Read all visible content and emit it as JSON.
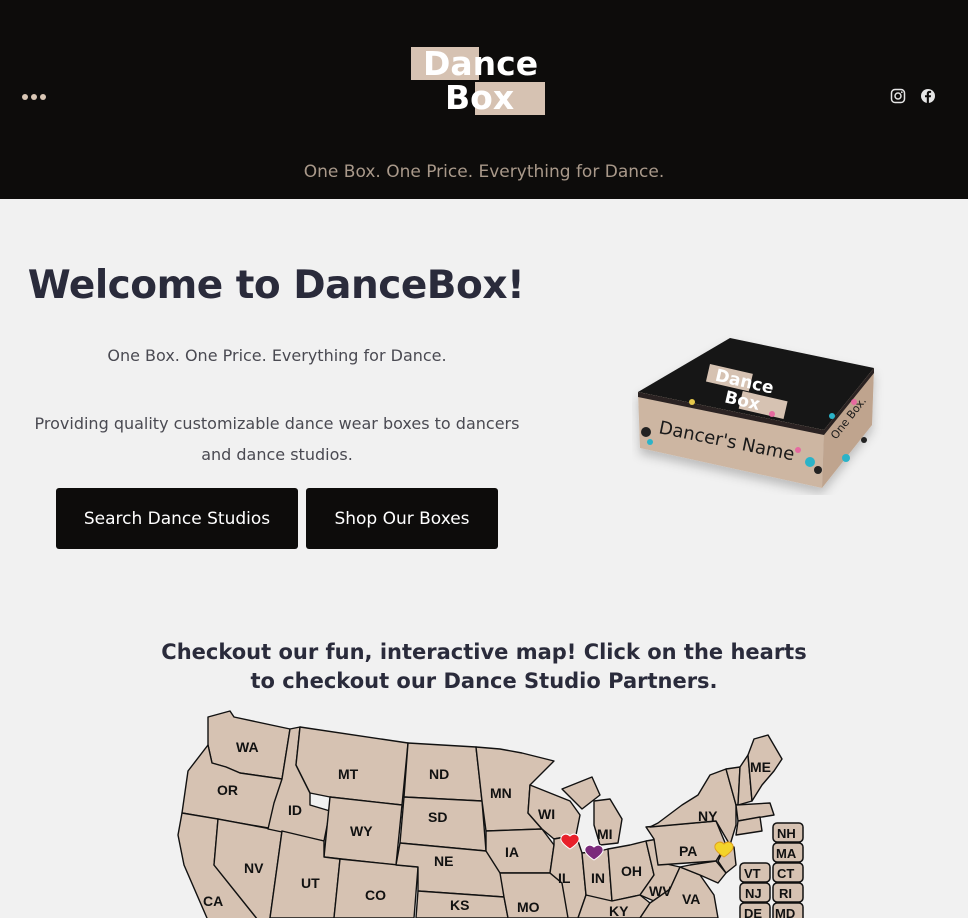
{
  "header": {
    "logo_line1": "Dance",
    "logo_line2": "Box",
    "tagline": "One Box. One Price. Everything for Dance.",
    "menu_icon": "more-dots-icon",
    "social_icons": [
      "instagram-icon",
      "facebook-icon"
    ],
    "accent_color": "#d6c2b2",
    "background_color": "#0d0c0b"
  },
  "hero": {
    "title": "Welcome to DanceBox!",
    "subtitle": "One Box. One Price. Everything for Dance.",
    "description": "Providing quality customizable dance wear boxes to dancers and dance studios.",
    "buttons": {
      "search": "Search Dance Studios",
      "shop": "Shop Our Boxes"
    },
    "box_image": {
      "logo_line1": "Dance",
      "logo_line2": "Box",
      "name_text": "Dancer's Name",
      "side_text": "One Box."
    }
  },
  "map_section": {
    "title": "Checkout our fun, interactive map! Click on the hearts to checkout our Dance Studio Partners.",
    "states": [
      "WA",
      "OR",
      "ID",
      "MT",
      "ND",
      "MN",
      "WI",
      "MI",
      "NY",
      "ME",
      "SD",
      "WY",
      "NV",
      "UT",
      "CA",
      "CO",
      "NE",
      "IA",
      "IL",
      "IN",
      "OH",
      "PA",
      "WV",
      "VA",
      "KS",
      "MO",
      "KY"
    ],
    "small_states": [
      "NH",
      "MA",
      "VT",
      "CT",
      "NJ",
      "RI",
      "DE",
      "MD"
    ],
    "hearts": [
      {
        "color": "#e8202a",
        "near": "IL"
      },
      {
        "color": "#7b2a7b",
        "near": "IN"
      },
      {
        "color": "#f3d42a",
        "near": "NJ"
      }
    ]
  }
}
